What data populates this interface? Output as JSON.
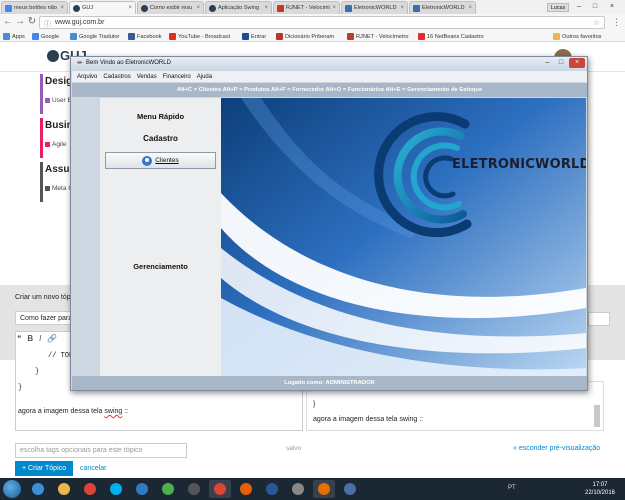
{
  "browser": {
    "tabs": [
      {
        "label": "meus botões não",
        "icon": "google-icon",
        "color": "#4285f4"
      },
      {
        "label": "GUJ",
        "icon": "guj-icon",
        "color": "#2c3e50"
      },
      {
        "label": "Como exibir resu",
        "icon": "guj-icon",
        "color": "#2c3e50"
      },
      {
        "label": "Aplicação Swing",
        "icon": "guj-icon",
        "color": "#2c3e50"
      },
      {
        "label": "RJNET - Velocimi",
        "icon": "rjnet-icon",
        "color": "#c0392b"
      },
      {
        "label": "EletronicWORLD",
        "icon": "page-icon",
        "color": "#3b6db3"
      },
      {
        "label": "EletronicWORLD",
        "icon": "page-icon",
        "color": "#3b6db3"
      }
    ],
    "profile": "Lucas",
    "url": "www.guj.com.br",
    "bookmarks": [
      {
        "label": "Apps",
        "color": "#4a8ad6"
      },
      {
        "label": "Google",
        "color": "#4285f4"
      },
      {
        "label": "Google Tradutor",
        "color": "#4a8ad6"
      },
      {
        "label": "Facebook",
        "color": "#3b5998"
      },
      {
        "label": "YouTube - Broadcast",
        "color": "#e52d27"
      },
      {
        "label": "Entrar",
        "color": "#1f4f8b"
      },
      {
        "label": "Dicionário Priberam",
        "color": "#b03a2e"
      },
      {
        "label": "RJNET - Velocímetro",
        "color": "#c0392b"
      },
      {
        "label": "16 NetBeans Cadastro",
        "color": "#e52d27"
      }
    ],
    "other_bookmarks": "Outros favoritos"
  },
  "webpage": {
    "logo": "GUJ",
    "categories": [
      {
        "title": "Design",
        "sub": "User E",
        "color": "#9b59b6"
      },
      {
        "title": "Busine",
        "sub": "Agile",
        "color": "#e91e63"
      },
      {
        "title": "Assun",
        "sub": "Meta G",
        "color": "#555555"
      }
    ],
    "composer_label": "Criar um novo tópi",
    "composer_title": "Como fazer para ti",
    "editor_toolbar": [
      "B",
      "I",
      "🔗"
    ],
    "code": [
      "// TODO",
      "}",
      "}"
    ],
    "editor_text_prefix": "agora a imagem dessa tela ",
    "editor_text_word": "swing",
    "editor_text_suffix": " ::",
    "preview_brace": "}",
    "preview_text": "agora a imagem dessa tela swing ::",
    "tags_placeholder": "escolha tags opcionais para este tópico",
    "saved": "salvo",
    "hide_preview": "« esconder pré-visualização",
    "create_button": "+ Criar Tópico",
    "cancel": "cancelar"
  },
  "app": {
    "window_title": "Bem Vindo ao EletronicWORLD",
    "menus": [
      "Arquivo",
      "Cadastros",
      "Vendas",
      "Financeiro",
      "Ajuda"
    ],
    "shortcuts": "Alt+C = Clientes  Alt+P = Produtos  Alt+F = Fornecedor  Alt+O = Funcionários  Alt+E = Gerenciamento de Estoque",
    "menu_rapido": "Menu Rápido",
    "cadastro": "Cadastro",
    "clientes_button": "Clientes",
    "gerenciamento": "Gerenciamento",
    "brand": "ELETRONICWORLD",
    "status": "Logado como: ADMINISTRADOR"
  },
  "taskbar": {
    "apps": [
      {
        "icon": "ie-icon",
        "color": "#3a8fd9"
      },
      {
        "icon": "folder-icon",
        "color": "#e8b84a"
      },
      {
        "icon": "chrome-icon",
        "color": "#db4437"
      },
      {
        "icon": "skype-icon",
        "color": "#00aff0"
      },
      {
        "icon": "netbeans-icon",
        "color": "#2d7bc4"
      },
      {
        "icon": "paint-icon",
        "color": "#4caf50"
      },
      {
        "icon": "media-icon",
        "color": "#555555"
      },
      {
        "icon": "chrome-icon",
        "color": "#db4437"
      },
      {
        "icon": "firefox-icon",
        "color": "#e66000"
      },
      {
        "icon": "word-icon",
        "color": "#2b579a"
      },
      {
        "icon": "app-icon",
        "color": "#888888"
      },
      {
        "icon": "java-icon",
        "color": "#e76f00"
      },
      {
        "icon": "app-icon",
        "color": "#4a6fa5"
      }
    ],
    "tray_lang": "PT",
    "time": "17:07",
    "date": "22/10/2016"
  }
}
